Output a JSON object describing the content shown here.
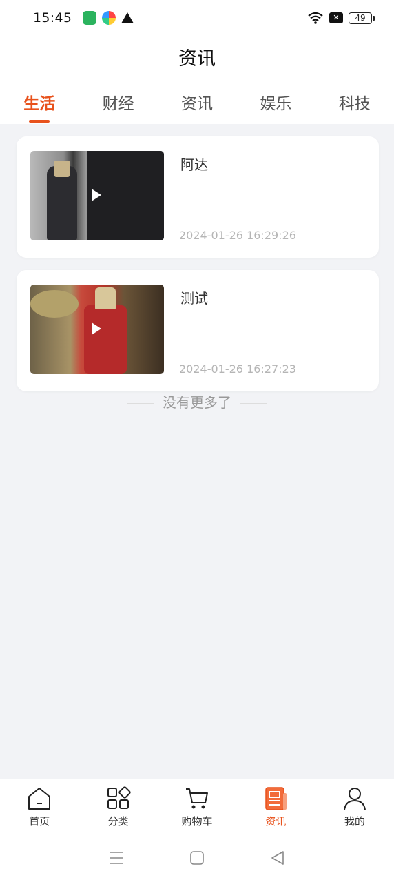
{
  "status_bar": {
    "time": "15:45",
    "battery": "49"
  },
  "header": {
    "title": "资讯"
  },
  "tabs": [
    {
      "label": "生活",
      "active": true
    },
    {
      "label": "财经",
      "active": false
    },
    {
      "label": "资讯",
      "active": false
    },
    {
      "label": "娱乐",
      "active": false
    },
    {
      "label": "科技",
      "active": false
    }
  ],
  "articles": [
    {
      "title": "阿达",
      "time": "2024-01-26 16:29:26"
    },
    {
      "title": "测试",
      "time": "2024-01-26 16:27:23"
    }
  ],
  "list_end_text": "没有更多了",
  "bottom_nav": [
    {
      "label": "首页",
      "icon": "home-icon"
    },
    {
      "label": "分类",
      "icon": "category-icon"
    },
    {
      "label": "购物车",
      "icon": "cart-icon"
    },
    {
      "label": "资讯",
      "icon": "news-icon",
      "active": true
    },
    {
      "label": "我的",
      "icon": "profile-icon"
    }
  ],
  "colors": {
    "accent": "#e8521c",
    "background": "#f2f3f6"
  }
}
